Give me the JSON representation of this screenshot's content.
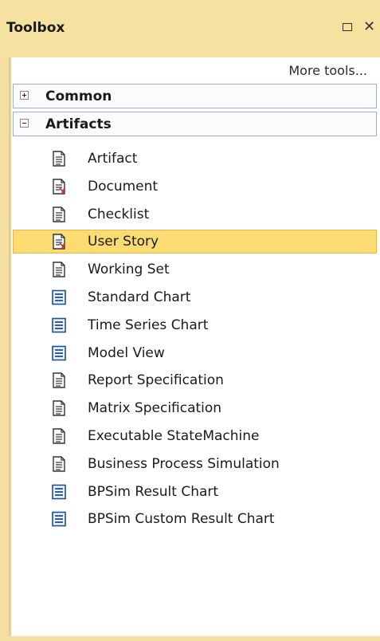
{
  "window": {
    "title": "Toolbox"
  },
  "more_tools": "More tools...",
  "groups": [
    {
      "label": "Common",
      "expanded": false,
      "expander_icon": "plus-icon"
    },
    {
      "label": "Artifacts",
      "expanded": true,
      "expander_icon": "minus-icon"
    }
  ],
  "items": [
    {
      "label": "Artifact",
      "icon": "document-icon",
      "selected": false
    },
    {
      "label": "Document",
      "icon": "document-red-icon",
      "selected": false
    },
    {
      "label": "Checklist",
      "icon": "document-icon",
      "selected": false
    },
    {
      "label": "User Story",
      "icon": "document-red-icon",
      "selected": true
    },
    {
      "label": "Working Set",
      "icon": "document-icon",
      "selected": false
    },
    {
      "label": "Standard Chart",
      "icon": "chart-icon",
      "selected": false
    },
    {
      "label": "Time Series Chart",
      "icon": "chart-icon",
      "selected": false
    },
    {
      "label": "Model View",
      "icon": "chart-icon",
      "selected": false
    },
    {
      "label": "Report Specification",
      "icon": "document-icon",
      "selected": false
    },
    {
      "label": "Matrix Specification",
      "icon": "document-icon",
      "selected": false
    },
    {
      "label": "Executable StateMachine",
      "icon": "document-icon",
      "selected": false
    },
    {
      "label": "Business Process Simulation",
      "icon": "document-icon",
      "selected": false
    },
    {
      "label": "BPSim Result Chart",
      "icon": "chart-icon",
      "selected": false
    },
    {
      "label": "BPSim Custom Result Chart",
      "icon": "chart-icon",
      "selected": false
    }
  ],
  "colors": {
    "titlebar": "#f6e2a0",
    "selection": "#fadc72",
    "group_border": "#9db0d0"
  }
}
